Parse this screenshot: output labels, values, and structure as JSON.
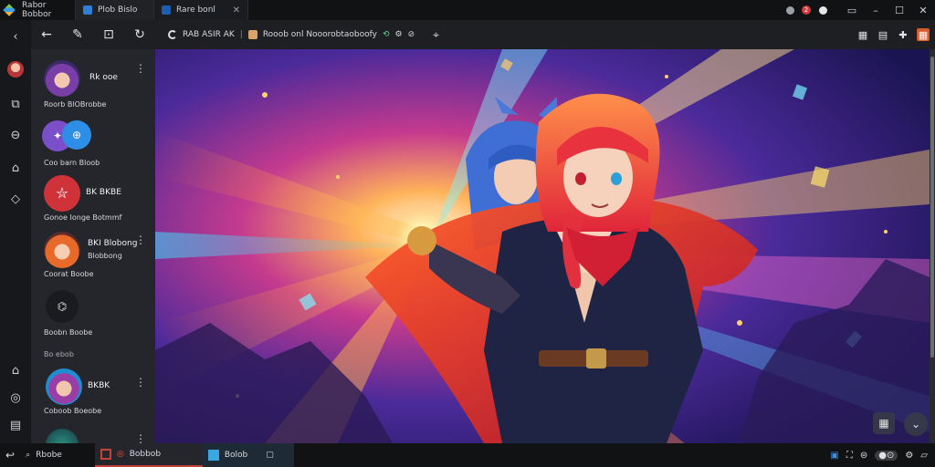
{
  "titlebar": {
    "tabs": [
      {
        "label": "Rabor Bobbor"
      },
      {
        "label": "Plob Bislo"
      },
      {
        "label": "Rare bonl"
      }
    ],
    "notification_count": "2"
  },
  "toolbar": {
    "address_title": "RAB ASIR AK",
    "address_text": "Rooob onl Nooorobtaoboofy"
  },
  "sidebar": {
    "items": [
      {
        "name": "Rk ooe",
        "sub": "Roorb BlOBrobbe"
      },
      {
        "name": "",
        "sub": "Coo barn Bloob"
      },
      {
        "name": "BK BKBE",
        "sub": "Gonoe Ionge Botmmf"
      },
      {
        "name": "BKI Blobong",
        "sub2": "Blobbong",
        "sub": "Coorat Boobe"
      },
      {
        "name": "",
        "sub": "Boobn Boobe"
      },
      {
        "name": "BKBK",
        "sub": "Coboob Boeobe"
      }
    ],
    "section_label": "Bo ebob"
  },
  "taskbar": {
    "items": [
      {
        "label": "Rbobe"
      },
      {
        "label": "Bobbob"
      },
      {
        "label": "Bolob"
      }
    ]
  },
  "colors": {
    "accent_red": "#c2413a",
    "accent_blue": "#2f7fd6",
    "sidebar_bg": "#25262b"
  }
}
